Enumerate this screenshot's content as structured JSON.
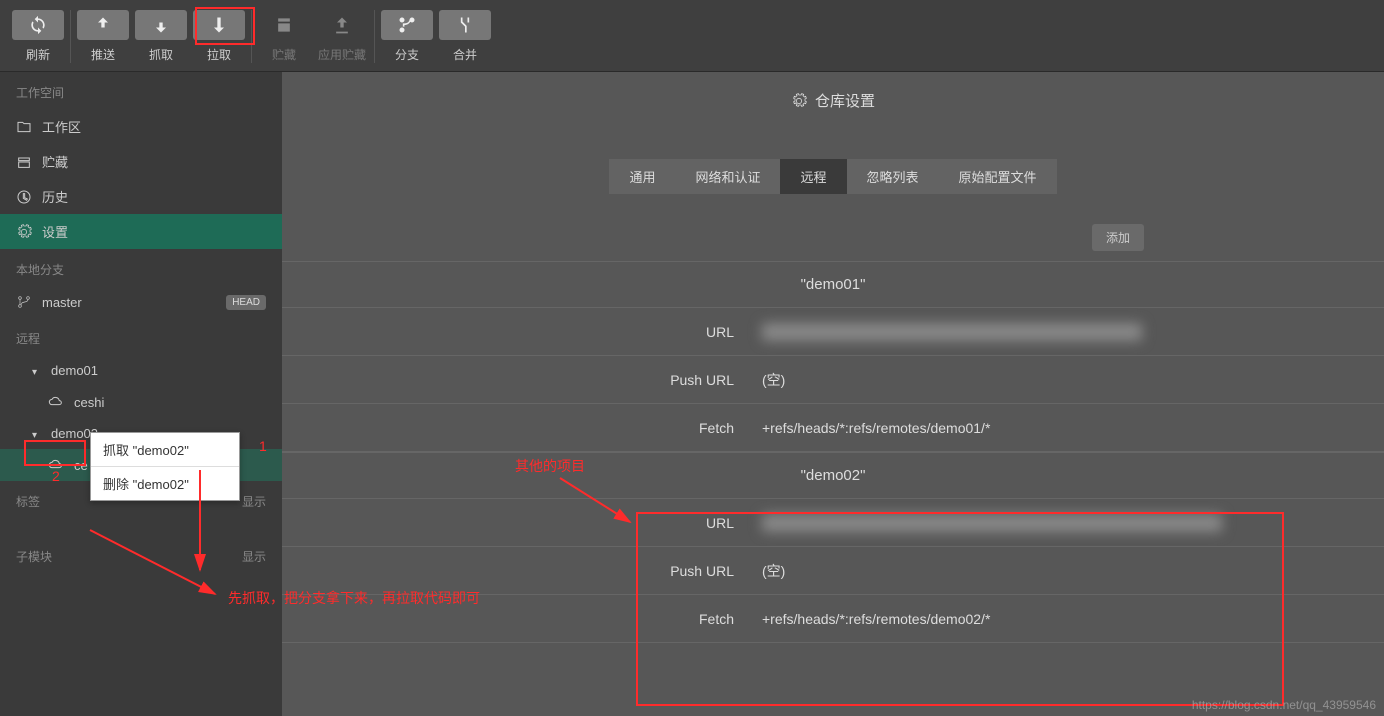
{
  "toolbar": {
    "refresh": "刷新",
    "push": "推送",
    "fetch": "抓取",
    "pull": "拉取",
    "stash": "贮藏",
    "apply_stash": "应用贮藏",
    "branch": "分支",
    "merge": "合并"
  },
  "sidebar": {
    "workspace": {
      "title": "工作空间",
      "work_area": "工作区",
      "stash": "贮藏",
      "history": "历史",
      "settings": "设置"
    },
    "local_branches": {
      "title": "本地分支",
      "master": "master",
      "head_badge": "HEAD"
    },
    "remotes": {
      "title": "远程",
      "items": [
        {
          "name": "demo01",
          "children": [
            "ceshi"
          ]
        },
        {
          "name": "demo02",
          "children": [
            "ce"
          ]
        }
      ]
    },
    "tags": {
      "title": "标签",
      "show": "显示"
    },
    "submodules": {
      "title": "子模块",
      "show": "显示"
    }
  },
  "context_menu": {
    "fetch_item": "抓取 \"demo02\"",
    "delete_item": "删除 \"demo02\""
  },
  "main": {
    "header": "仓库设置",
    "tabs": {
      "general": "通用",
      "network_auth": "网络和认证",
      "remote": "远程",
      "ignore": "忽略列表",
      "raw_config": "原始配置文件"
    },
    "add_btn": "添加",
    "remotes": [
      {
        "name": "\"demo01\"",
        "url_label": "URL",
        "push_url_label": "Push URL",
        "push_url_value": "(空)",
        "fetch_label": "Fetch",
        "fetch_value": "+refs/heads/*:refs/remotes/demo01/*"
      },
      {
        "name": "\"demo02\"",
        "url_label": "URL",
        "push_url_label": "Push URL",
        "push_url_value": "(空)",
        "fetch_label": "Fetch",
        "fetch_value": "+refs/heads/*:refs/remotes/demo02/*"
      }
    ]
  },
  "annotations": {
    "num1": "1",
    "num2": "2",
    "other_project": "其他的项目",
    "instruction": "先抓取，把分支拿下来，再拉取代码即可"
  },
  "watermark": "https://blog.csdn.net/qq_43959546"
}
